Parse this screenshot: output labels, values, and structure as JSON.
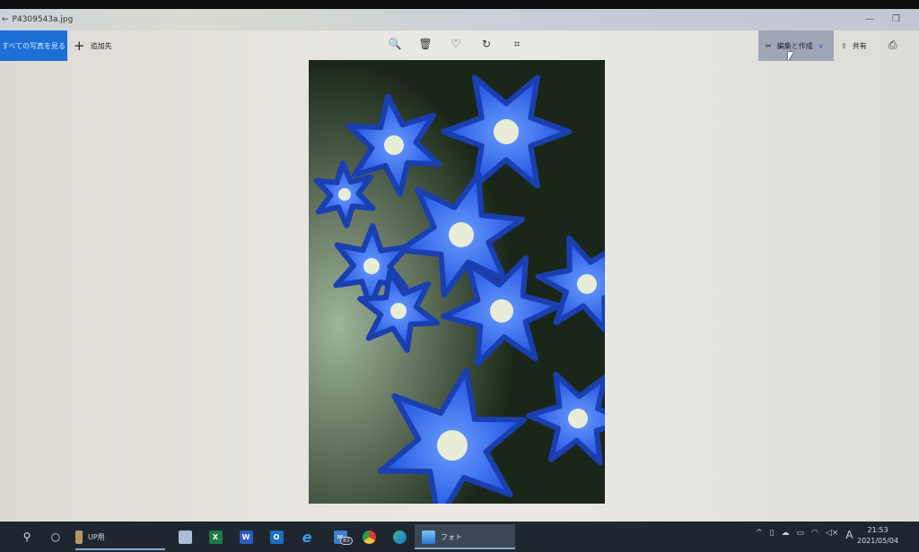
{
  "window": {
    "title": "P4309543a.jpg",
    "back": "←",
    "minimize": "—",
    "maximize": "❐"
  },
  "toolbar": {
    "all_photos": "すべての写真を見る",
    "add_to": "追加先",
    "add_icon": "+",
    "zoom_icon": "🔍",
    "delete_icon": "🗑",
    "favorite_icon": "♡",
    "rotate_icon": "↻",
    "crop_icon": "⌗",
    "edit_create": "編集と作成",
    "edit_icon": "✂",
    "chevron": "∨",
    "share": "共有",
    "share_icon": "⇪",
    "print_icon": "⎙"
  },
  "photo": {
    "colors": {
      "background": "#1d2a1a",
      "petal": "#2a62f0",
      "petal_light": "#4f86ff",
      "center": "#e8edd8"
    }
  },
  "taskbar": {
    "search_icon": "⚲",
    "cortana_icon": "○",
    "folder_label": "UP用",
    "apps": [
      {
        "name": "notepad",
        "glyph": ""
      },
      {
        "name": "excel",
        "glyph": "X"
      },
      {
        "name": "word",
        "glyph": "W"
      },
      {
        "name": "outlook",
        "glyph": "O"
      },
      {
        "name": "ie",
        "glyph": "e"
      },
      {
        "name": "mail",
        "glyph": "✉"
      },
      {
        "name": "chrome",
        "glyph": ""
      },
      {
        "name": "edge",
        "glyph": ""
      }
    ],
    "mail_badge": "83",
    "photos_label": "フォト",
    "tray": [
      "^",
      "▯",
      "☁",
      "▭",
      "◠",
      "◁×",
      "A"
    ],
    "time": "21:53",
    "date": "2021/05/04"
  }
}
